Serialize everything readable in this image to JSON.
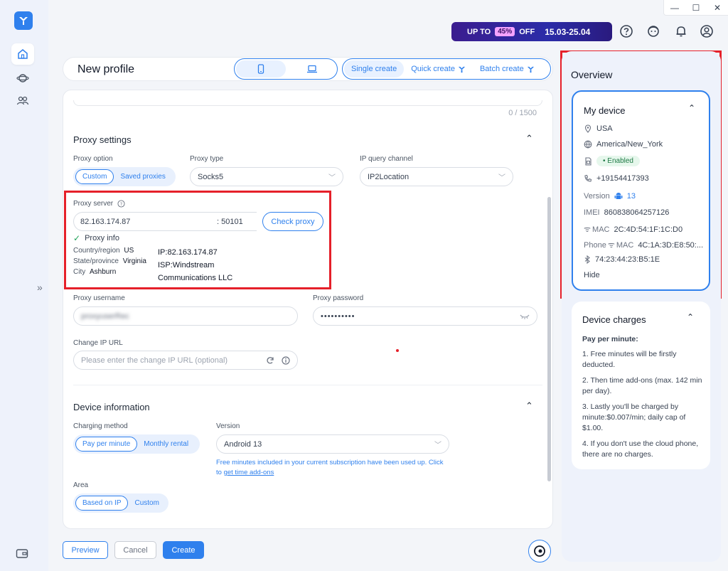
{
  "window": {
    "controls": [
      "—",
      "☐",
      "✕"
    ]
  },
  "promo": {
    "prefix": "UP TO",
    "percent": "45%",
    "suffix": "OFF",
    "dates": "15.03-25.04"
  },
  "header": {
    "title": "New profile",
    "modes": [
      "Single create",
      "Quick create",
      "Batch create"
    ]
  },
  "form": {
    "counter": "0 / 1500",
    "proxy": {
      "section_title": "Proxy settings",
      "option_label": "Proxy option",
      "options": [
        "Custom",
        "Saved proxies"
      ],
      "type_label": "Proxy type",
      "type_value": "Socks5",
      "channel_label": "IP query channel",
      "channel_value": "IP2Location",
      "server_label": "Proxy server",
      "host": "82.163.174.87",
      "port": ": 50101",
      "check_label": "Check proxy",
      "info_title": "Proxy info",
      "country_label": "Country/region",
      "country": "US",
      "state_label": "State/province",
      "state": "Virginia",
      "city_label": "City",
      "city": "Ashburn",
      "ip_line": "IP:82.163.174.87",
      "isp_line1": "ISP:Windstream",
      "isp_line2": "Communications LLC",
      "username_label": "Proxy username",
      "username_value": "proxyuserRec",
      "password_label": "Proxy password",
      "password_value": "••••••••••",
      "change_ip_label": "Change IP URL",
      "change_ip_placeholder": "Please enter the change IP URL (optional)"
    },
    "device": {
      "section_title": "Device information",
      "charging_label": "Charging method",
      "charging_options": [
        "Pay per minute",
        "Monthly rental"
      ],
      "version_label": "Version",
      "version_value": "Android 13",
      "note_line1": "Free minutes included in your current subscription have been used up. Click",
      "note_line2_prefix": "to ",
      "note_link": "get time add-ons",
      "area_label": "Area",
      "area_options": [
        "Based on IP",
        "Custom"
      ]
    }
  },
  "footer": {
    "preview": "Preview",
    "cancel": "Cancel",
    "create": "Create"
  },
  "overview": {
    "title": "Overview",
    "device_card": {
      "title": "My device",
      "country": "USA",
      "timezone": "America/New_York",
      "sim_status": "Enabled",
      "phone": "+19154417393",
      "version_label": "Version",
      "version_value": "13",
      "imei_label": "IMEI",
      "imei": "860838064257126",
      "mac_label": "MAC",
      "mac": "2C:4D:54:1F:1C:D0",
      "phone_mac_prefix": "Phone",
      "phone_mac_label": "MAC",
      "phone_mac": "4C:1A:3D:E8:50:...",
      "bluetooth": "74:23:44:23:B5:1E",
      "hide": "Hide"
    },
    "charges_card": {
      "title": "Device charges",
      "heading": "Pay per minute:",
      "item1": "1. Free minutes will be firstly deducted.",
      "item2": "2. Then time add-ons (max. 142 min per day).",
      "item3": "3. Lastly you'll be charged by minute:$0.007/min; daily cap of $1.00.",
      "item4": "4. If you don't use the cloud phone, there are no charges."
    }
  },
  "colors": {
    "accent": "#2f80ed",
    "highlight": "#e5202a",
    "success": "#22a35a"
  }
}
